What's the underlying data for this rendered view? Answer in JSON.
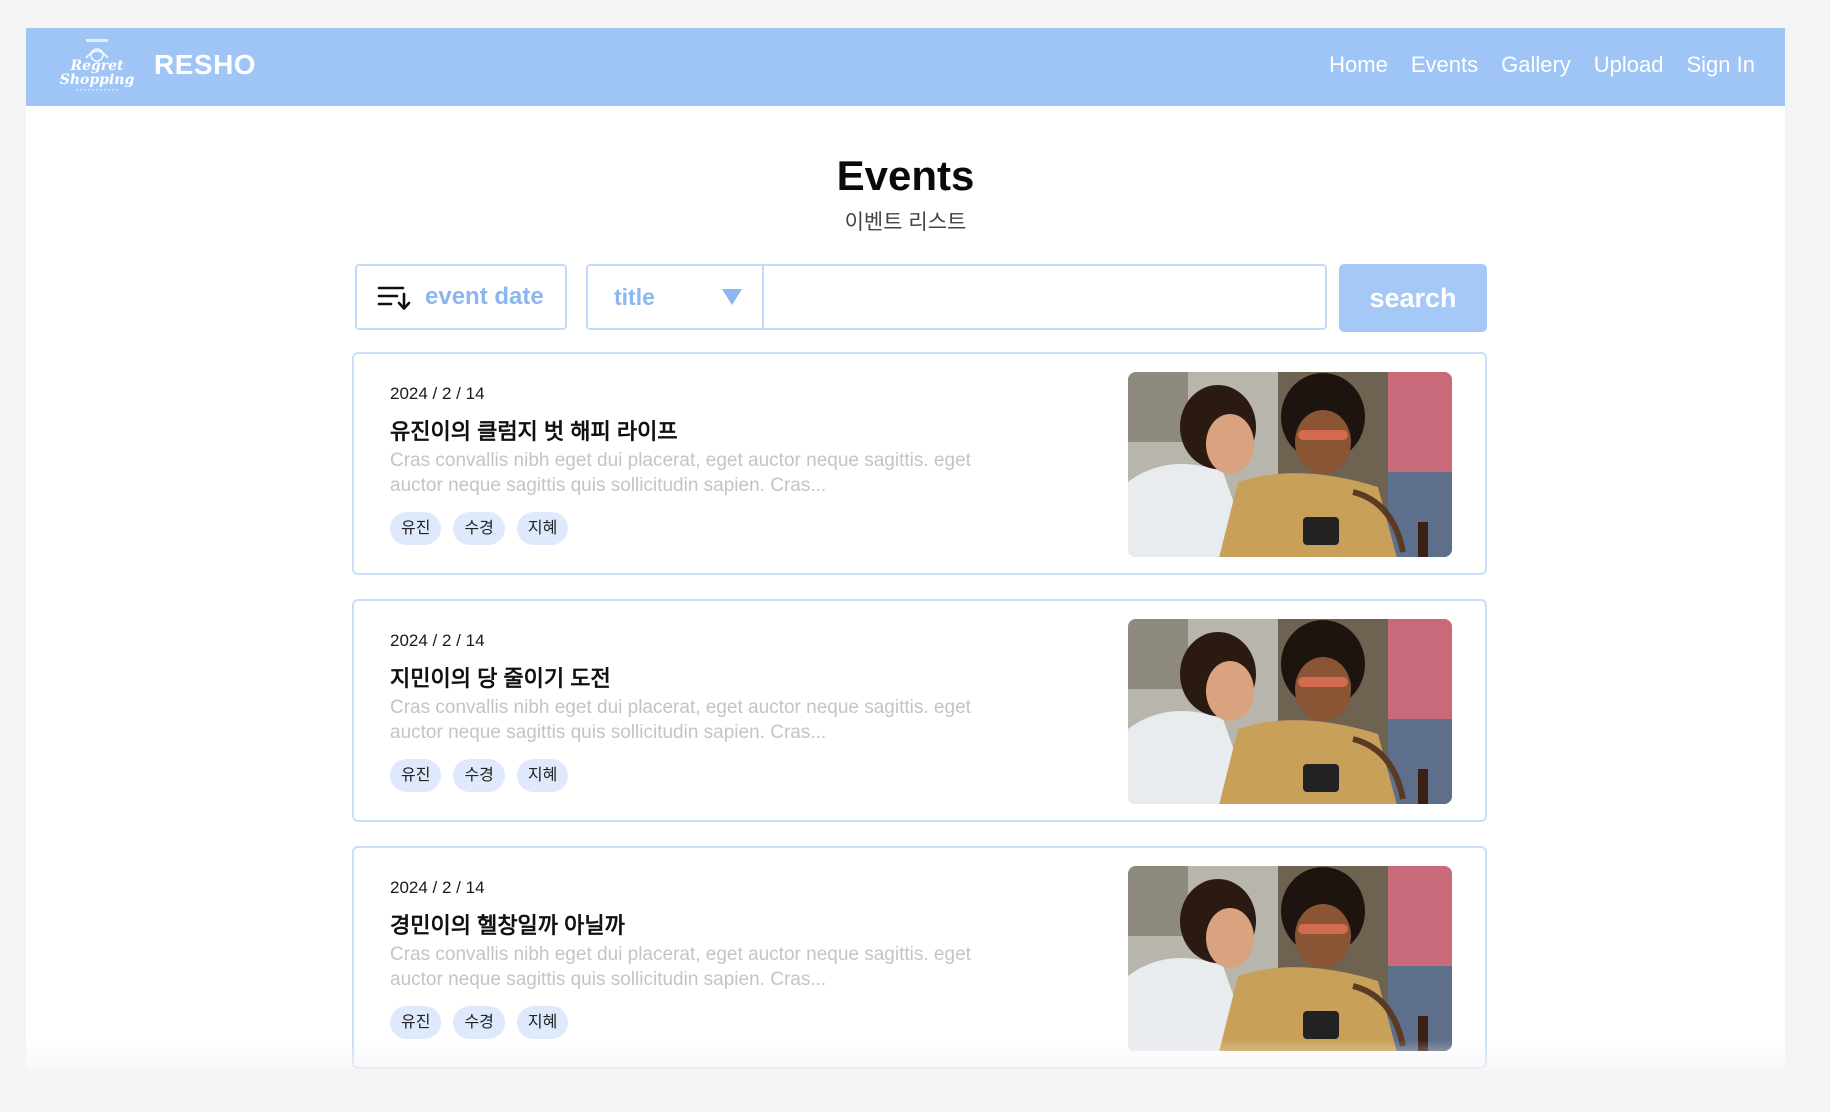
{
  "navbar": {
    "logo_text_line1": "Regret",
    "logo_text_line2": "Shopping",
    "brand": "RESHO",
    "links": [
      "Home",
      "Events",
      "Gallery",
      "Upload",
      "Sign In"
    ]
  },
  "page": {
    "title": "Events",
    "subtitle": "이벤트 리스트"
  },
  "controls": {
    "sort_label": "event date",
    "filter_selected": "title",
    "search_value": "",
    "search_button": "search"
  },
  "events": [
    {
      "date": "2024 / 2 / 14",
      "title": "유진이의 클럼지 벗 해피 라이프",
      "desc_line1": "Cras convallis nibh eget dui placerat, eget auctor neque sagittis. eget",
      "desc_line2": "auctor neque sagittis quis sollicitudin sapien. Cras...",
      "tags": [
        "유진",
        "수경",
        "지혜"
      ]
    },
    {
      "date": "2024 / 2 / 14",
      "title": "지민이의 당 줄이기 도전",
      "desc_line1": "Cras convallis nibh eget dui placerat, eget auctor neque sagittis. eget",
      "desc_line2": "auctor neque sagittis quis sollicitudin sapien. Cras...",
      "tags": [
        "유진",
        "수경",
        "지혜"
      ]
    },
    {
      "date": "2024 / 2 / 14",
      "title": "경민이의 헬창일까 아닐까",
      "desc_line1": "Cras convallis nibh eget dui placerat, eget auctor neque sagittis. eget",
      "desc_line2": "auctor neque sagittis quis sollicitudin sapien. Cras...",
      "tags": [
        "유진",
        "수경",
        "지혜"
      ]
    }
  ],
  "colors": {
    "navbar": "#9fc4f6",
    "accent": "#8cb6ef",
    "button": "#a5c8f6",
    "border": "#c3dafa",
    "tag_bg": "#deeafb"
  },
  "icons": {
    "sort": "sort-descending-icon",
    "dropdown": "chevron-down-icon"
  }
}
